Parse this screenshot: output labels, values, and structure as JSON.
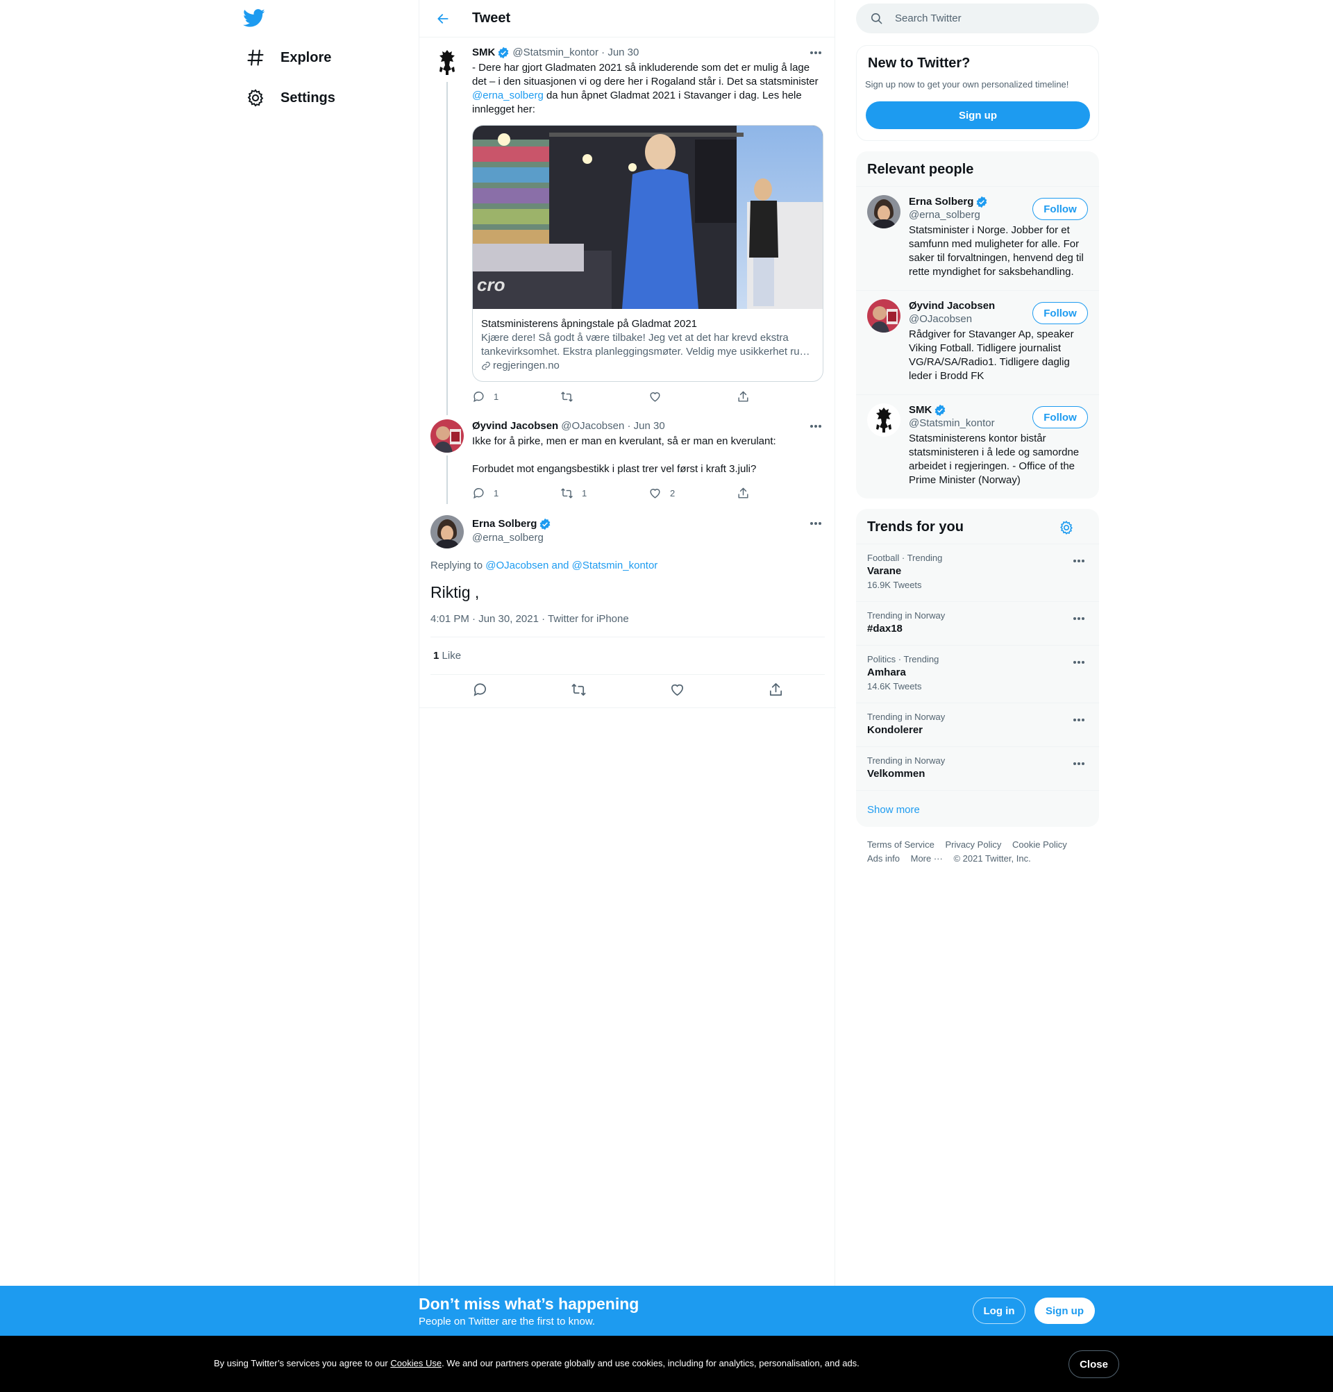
{
  "nav": {
    "logo_icon": "twitter-bird-icon",
    "items": [
      {
        "label": "Explore",
        "icon": "hashtag-icon"
      },
      {
        "label": "Settings",
        "icon": "gear-icon"
      }
    ]
  },
  "header": {
    "title": "Tweet"
  },
  "thread": [
    {
      "name": "SMK",
      "handle": "@Statsmin_kontor",
      "date": "Jun 30",
      "verified": true,
      "text_before": "- Dere har gjort Gladmaten 2021 så inkluderende som det er mulig å lage det – i den situasjonen vi og dere her i Rogaland står i. Det sa statsminister ",
      "mention": "@erna_solberg",
      "text_after": " da hun åpnet Gladmat 2021 i Stavanger i dag. Les hele innlegget her:",
      "card": {
        "title": "Statsministerens åpningstale på Gladmat 2021",
        "description": "Kjære dere! Så godt å være tilbake! Jeg vet at det har krevd ekstra tankevirksomhet. Ekstra planleggingsmøter. Veldig mye usikkerhet ru…",
        "domain": "regjeringen.no"
      },
      "replies": "1",
      "retweets": "",
      "likes": ""
    },
    {
      "name": "Øyvind Jacobsen",
      "handle": "@OJacobsen",
      "date": "Jun 30",
      "line1": "Ikke for å pirke, men er man en kverulant, så er man en kverulant:",
      "line2": "Forbudet mot engangsbestikk i plast trer vel først i kraft 3.juli?",
      "replies": "1",
      "retweets": "1",
      "likes": "2"
    }
  ],
  "focused": {
    "name": "Erna Solberg",
    "handle": "@erna_solberg",
    "replying_label": "Replying to",
    "replying_to": "@OJacobsen and @Statsmin_kontor",
    "text": "Riktig ,",
    "timestamp": "4:01 PM · Jun 30, 2021 · Twitter for iPhone",
    "like_count": "1",
    "like_label": "Like"
  },
  "search": {
    "placeholder": "Search Twitter"
  },
  "new_to_twitter": {
    "title": "New to Twitter?",
    "subtitle": "Sign up now to get your own personalized timeline!",
    "button": "Sign up"
  },
  "relevant_people": {
    "title": "Relevant people",
    "people": [
      {
        "name": "Erna Solberg",
        "handle": "@erna_solberg",
        "follow": "Follow",
        "bio": "Statsminister i Norge. Jobber for et samfunn med muligheter for alle. For saker til forvaltningen, henvend deg til rette myndighet for saksbehandling."
      },
      {
        "name": "Øyvind Jacobsen",
        "handle": "@OJacobsen",
        "follow": "Follow",
        "bio": "Rådgiver for Stavanger Ap, speaker Viking Fotball. Tidligere journalist VG/RA/SA/Radio1. Tidligere daglig leder i Brodd FK"
      },
      {
        "name": "SMK",
        "handle": "@Statsmin_kontor",
        "follow": "Follow",
        "bio": "Statsministerens kontor bistår statsministeren i å lede og samordne arbeidet i regjeringen. - Office of the Prime Minister (Norway)"
      }
    ]
  },
  "trends": {
    "title": "Trends for you",
    "items": [
      {
        "category": "Football · Trending",
        "name": "Varane",
        "count": "16.9K Tweets"
      },
      {
        "category": "Trending in Norway",
        "name": "#dax18",
        "count": ""
      },
      {
        "category": "Politics · Trending",
        "name": "Amhara",
        "count": "14.6K Tweets"
      },
      {
        "category": "Trending in Norway",
        "name": "Kondolerer",
        "count": ""
      },
      {
        "category": "Trending in Norway",
        "name": "Velkommen",
        "count": ""
      }
    ],
    "show_more": "Show more"
  },
  "footer": {
    "links": [
      "Terms of Service",
      "Privacy Policy",
      "Cookie Policy",
      "Ads info",
      "More ···"
    ],
    "copyright": "© 2021 Twitter, Inc."
  },
  "banner": {
    "heading": "Don’t miss what’s happening",
    "sub": "People on Twitter are the first to know.",
    "login": "Log in",
    "signup": "Sign up"
  },
  "cookie": {
    "text_before": "By using Twitter’s services you agree to our ",
    "link": "Cookies Use",
    "text_after": ". We and our partners operate globally and use cookies, including for analytics, personalisation, and ads.",
    "close": "Close"
  },
  "colors": {
    "accent": "#1d9bf0",
    "text": "#0f1419",
    "muted": "#536471",
    "border": "#eff3f4"
  }
}
